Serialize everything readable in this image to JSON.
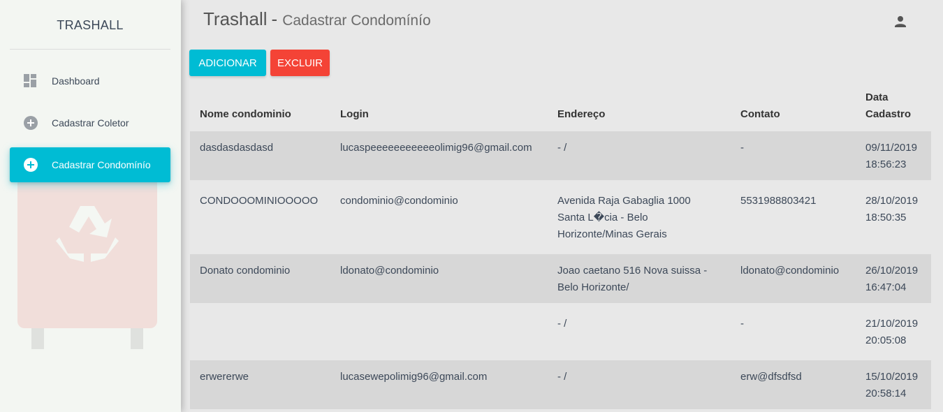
{
  "sidebar": {
    "brand": "TRASHALL",
    "items": [
      {
        "label": "Dashboard",
        "icon": "dashboard-icon"
      },
      {
        "label": "Cadastrar Coletor",
        "icon": "add-circle-icon"
      },
      {
        "label": "Cadastrar Condomínío",
        "icon": "add-circle-icon",
        "active": true
      }
    ]
  },
  "header": {
    "app_name": "Trashall",
    "separator": "-",
    "page_title": "Cadastrar Condomínío",
    "user_icon": "person-icon"
  },
  "toolbar": {
    "add_label": "ADICIONAR",
    "delete_label": "EXCLUIR"
  },
  "table": {
    "columns": [
      "Nome condominio",
      "Login",
      "Endereço",
      "Contato",
      "Data Cadastro"
    ],
    "rows": [
      [
        "dasdasdasdasd",
        "lucaspeeeeeeeeeeeolimig96@gmail.com",
        "- /",
        "-",
        "09/11/2019 18:56:23"
      ],
      [
        "CONDOOOMINIOOOOO",
        "condominio@condominio",
        "Avenida Raja Gabaglia 1000 Santa L�cia - Belo Horizonte/Minas Gerais",
        "5531988803421",
        "28/10/2019 18:50:35"
      ],
      [
        "Donato condominio",
        "ldonato@condominio",
        "Joao caetano 516 Nova suissa - Belo Horizonte/",
        "ldonato@condominio",
        "26/10/2019 16:47:04"
      ],
      [
        "",
        "",
        "- /",
        "-",
        "21/10/2019 20:05:08"
      ],
      [
        "erwererwe",
        "lucasewepolimig96@gmail.com",
        "- /",
        "erw@dfsdfsd",
        "15/10/2019 20:58:14"
      ]
    ]
  },
  "colors": {
    "accent": "#00bcd4",
    "danger": "#f44336",
    "sidebar_bg": "#f3f6f2",
    "main_bg": "#e8e8e8"
  }
}
